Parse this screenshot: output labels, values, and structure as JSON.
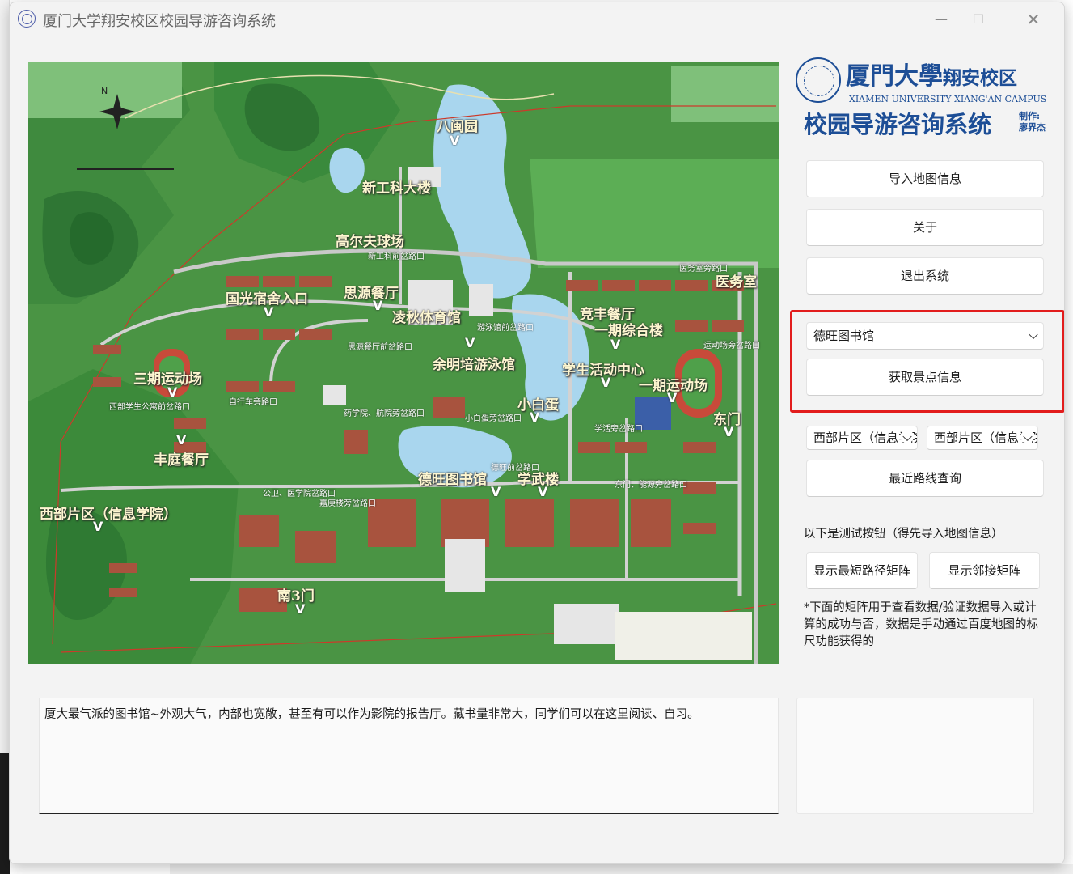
{
  "window": {
    "title": "厦门大学翔安校区校园导游咨询系统",
    "minimize_glyph": "—",
    "maximize_glyph": "☐",
    "close_glyph": "✕"
  },
  "logo": {
    "cn_name": "厦門大學",
    "campus": "翔安校区",
    "en_name": "XIAMEN UNIVERSITY XIANG'AN CAMPUS",
    "system_name": "校园导游咨询系统",
    "author_label": "制作:",
    "author_name": "廖界杰"
  },
  "buttons": {
    "import_map": "导入地图信息",
    "about": "关于",
    "exit": "退出系统",
    "get_info": "获取景点信息",
    "shortest_route": "最近路线查询",
    "show_shortest_matrix": "显示最短路径矩阵",
    "show_adjacency_matrix": "显示邻接矩阵"
  },
  "spot_select": {
    "selected": "德旺图书馆"
  },
  "route_from": {
    "selected": "西部片区（信息学院）"
  },
  "route_to": {
    "selected": "西部片区（信息学院）"
  },
  "test_label": "以下是测试按钮（得先导入地图信息）",
  "matrix_note": "*下面的矩阵用于查看数据/验证数据导入或计算的成功与否，数据是手动通过百度地图的标尺功能获得的",
  "description": "厦大最气派的图书馆~外观大气，内部也宽敞，甚至有可以作为影院的报告厅。藏书量非常大，同学们可以在这里阅读、自习。",
  "map": {
    "labels": [
      "八闽园",
      "新工科大楼",
      "高尔夫球场",
      "国光宿舍入口",
      "思源餐厅",
      "凌秋体育馆",
      "余明培游泳馆",
      "竞丰餐厅",
      "一期综合楼",
      "医务室",
      "学生活动中心",
      "一期运动场",
      "三期运动场",
      "小白蛋",
      "东门",
      "丰庭餐厅",
      "德旺图书馆",
      "学武楼",
      "西部片区（信息学院）",
      "南3门"
    ],
    "small_labels": [
      "新工科前岔路口",
      "医务室旁路口",
      "思源餐厅前岔路口",
      "游泳馆前岔路口",
      "运动场旁岔路口",
      "西部学生公寓前岔路口",
      "药学院、航院旁岔路口",
      "小白蛋旁岔路口",
      "学活旁岔路口",
      "德旺前岔路口",
      "东门、能源旁岔路口",
      "公卫、医学院岔路口",
      "嘉庚楼旁岔路口",
      "自行车旁路口"
    ],
    "compass_label": "N"
  }
}
